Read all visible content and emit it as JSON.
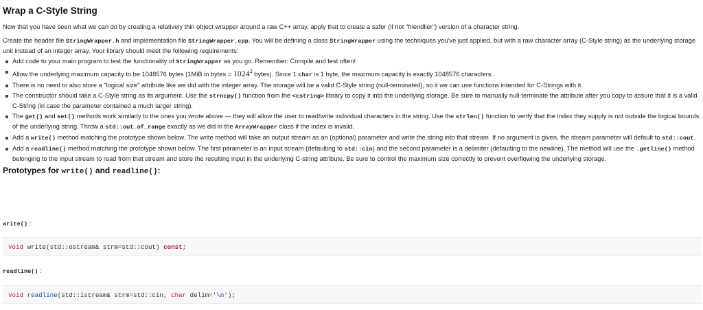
{
  "title": "Wrap a C-Style String",
  "intro": "Now that you have seen what we can do by creating a relatively thin object wrapper around a raw C++ array, apply that to create a safer (if not \"friendlier\") version of a character string.",
  "create": {
    "t1": "Create the header file ",
    "c1": "StringWrapper.h",
    "t2": " and implementation file ",
    "c2": "StringWrapper.cpp",
    "t3": ". You will be defining a class ",
    "c3": "StringWrapper",
    "t4": " using the techniques you've just applied, but with a raw character array (C-Style string) as the underlying storage unit instead of an integer array. Your library should meet the following requirements:"
  },
  "bullets": {
    "b1": {
      "t1": "Add code to your main program to test the functionality of ",
      "c1": "StringWrapper",
      "t2": " as you go. Remember: Compile and test often!"
    },
    "b2": {
      "t1": "Allow the underlying maximum capacity to be 1048576 bytes (1MiB in bytes = ",
      "math_base": "1024",
      "math_exp": "2",
      "t2": " bytes). Since 1 ",
      "c1": "char",
      "t3": " is 1 byte, the maximum capacity is exactly 1048576 characters."
    },
    "b3": {
      "t1": "There is no need to also store a \"logical size\" attribute like we did with the integer array. The storage will be a valid C-Style string (null-terminated), so it we can use functions intended for C-Strings with it."
    },
    "b4": {
      "t1": "The constructor should take a C-Style string as its argument. Use the ",
      "c1": "strncpy()",
      "t2": " function from the ",
      "c2": "<cstring>",
      "t3": " library to copy it into the underlying storage. Be sure to manually null-terminate the attribute after you copy to assure that it is a valid C-String (in case the parameter contained a much larger string)."
    },
    "b5": {
      "t1": "The ",
      "c1": "get()",
      "t2": " and ",
      "c2": "set()",
      "t3": " methods work similarly to the ones you wrote above — they will allow the user to read/write individual characters in the string. Use the ",
      "c3": "strlen()",
      "t4": " function to verify that the index they supply is not outside the logical bounds of the underlying string. Throw a ",
      "c4": "std::out_of_range",
      "t5": " exactly as we did in the ",
      "c5": "ArrayWrapper",
      "t6": " class if the index is invalid."
    },
    "b6": {
      "t1": "Add a ",
      "c1": "write()",
      "t2": " method matching the prototype shown below. The write method will take an output stream as an (optional) parameter and write the string into that stream. If no argument is given, the stream parameter will default to ",
      "c2": "std::cout",
      "t3": "."
    },
    "b7": {
      "t1": "Add a ",
      "c1": "readline()",
      "t2": " method matching the prototype shown below. The first parameter is an input stream (defaulting to ",
      "c2": "std::cin",
      "t3": ") and the second parameter is a delimiter (defaulting to the newline). The method will use the ",
      "c3": ".getline()",
      "t4": " method belonging to the input stream to read from that stream and store the resulting input in the underlying C-string attribute. Be sure to control the maximum size correctly to prevent overflowing the underlying storage."
    }
  },
  "prototypes": {
    "heading_t1": "Prototypes for ",
    "heading_c1": "write()",
    "heading_t2": " and ",
    "heading_c2": "readline()",
    "heading_t3": ":",
    "write_label": "write()",
    "write_colon": ":",
    "readline_label": "readline()",
    "readline_colon": ":",
    "write_code": {
      "kw_void": "void",
      "sig": " write(std::ostream& strm=std::cout) ",
      "kw_const": "const",
      "end": ";"
    },
    "readline_code": {
      "kw_void": "void",
      "sp": " ",
      "fn": "readline",
      "args1": "(std::istream& strm=std::cin, ",
      "kw_char": "char",
      "args2": " delim=",
      "str": "'\\n'",
      "end": ");"
    }
  },
  "colors": {
    "keyword": "#a71d5d",
    "function": "#1d4fa3",
    "string": "#183691",
    "code_bg": "#f7f7f7"
  }
}
